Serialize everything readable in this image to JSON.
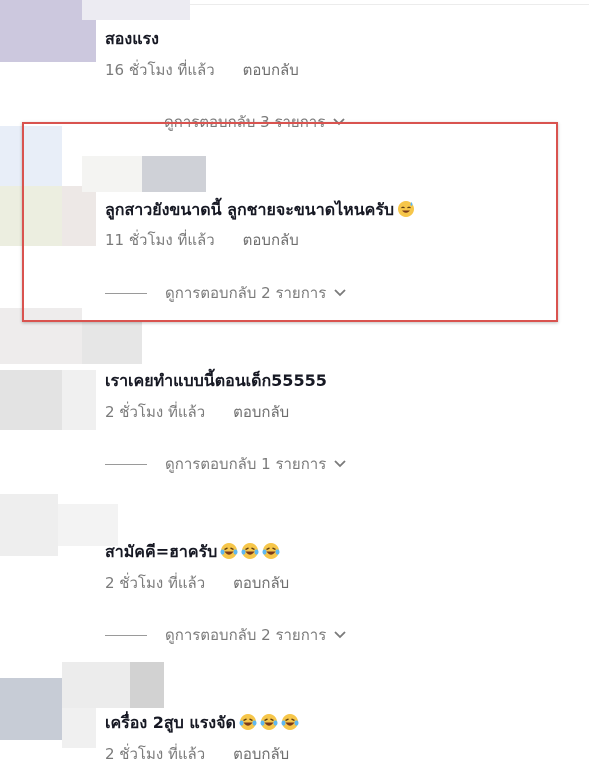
{
  "colors": {
    "highlight": "#d9534f",
    "text": "#161823",
    "meta": "#7a7a7a"
  },
  "comments": [
    {
      "text": "สองแรง",
      "time": "16 ชั่วโมง ที่แล้ว",
      "reply": "ตอบกลับ",
      "view_replies": "ดูการตอบกลับ 3 รายการ"
    },
    {
      "text": "ลูกสาวยังขนาดนี้ ลูกชายจะขนาดไหนครับ",
      "emoji": "smiling-face-with-sweat",
      "time": "11 ชั่วโมง ที่แล้ว",
      "reply": "ตอบกลับ",
      "view_replies": "ดูการตอบกลับ 2 รายการ"
    },
    {
      "text": "เราเคยทำแบบนี้ตอนเด็ก55555",
      "time": "2 ชั่วโมง ที่แล้ว",
      "reply": "ตอบกลับ",
      "view_replies": "ดูการตอบกลับ 1 รายการ"
    },
    {
      "text": "สามัคคี=ฮาครับ",
      "emoji": "laughing-crying-face",
      "time": "2 ชั่วโมง ที่แล้ว",
      "reply": "ตอบกลับ",
      "view_replies": "ดูการตอบกลับ 2 รายการ"
    },
    {
      "text": "เครื่อง 2สูบ แรงจัด",
      "emoji": "laughing-crying-face",
      "time": "2 ชั่วโมง ที่แล้ว",
      "reply": "ตอบกลับ"
    }
  ]
}
